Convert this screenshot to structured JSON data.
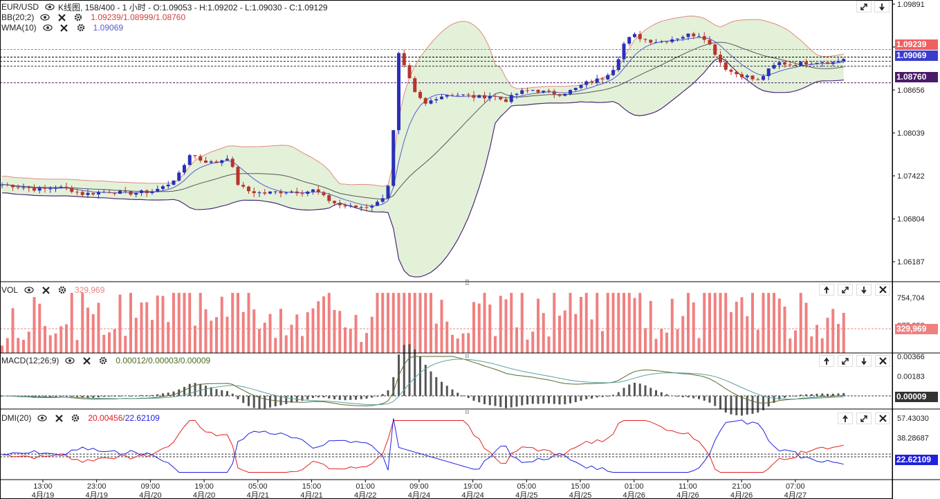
{
  "main": {
    "symbol": "EUR/USD",
    "info": "K线图, 158/400 - 1 小时 - O:1.09053 - H:1.09202 - L:1.09030 - C:1.09129",
    "indicators": [
      {
        "label": "BB(20;2)",
        "values": "1.09239/1.08999/1.08760"
      },
      {
        "label": "WMA(10)",
        "values": "1.09069"
      }
    ],
    "axis_ticks": [
      "1.09891",
      "1.09274",
      "1.08656",
      "1.08039",
      "1.07422",
      "1.06804",
      "1.06187"
    ],
    "price_tags": {
      "bb_upper": "1.09239",
      "wma": "1.09069",
      "bb_lower": "1.08760"
    }
  },
  "vol": {
    "label": "VOL",
    "value": "329,969",
    "axis_ticks": [
      "754,704",
      "377,352"
    ],
    "tag": "329,969"
  },
  "macd": {
    "label": "MACD(12;26;9)",
    "values": "0.00012/0.00003/0.00009",
    "axis_ticks": [
      "0.00366",
      "0.00183"
    ],
    "tag": "0.00009"
  },
  "dmi": {
    "label": "DMI(20)",
    "value_plus": "20.00456",
    "value_minus": "22.62109",
    "axis_ticks": [
      "57.43030",
      "38.28687"
    ],
    "tag": "22.62109"
  },
  "time_axis": {
    "times": [
      "13:00",
      "23:00",
      "09:00",
      "19:00",
      "05:00",
      "15:00",
      "01:00",
      "09:00",
      "19:00",
      "05:00",
      "15:00",
      "01:00",
      "11:00",
      "21:00",
      "07:00"
    ],
    "dates": [
      "4月/19",
      "4月/19",
      "4月/20",
      "4月/20",
      "4月/21",
      "4月/21",
      "4月/22",
      "4月/24",
      "4月/24",
      "4月/25",
      "4月/25",
      "4月/26",
      "4月/26",
      "4月/26",
      "4月/27"
    ]
  },
  "colors": {
    "up": "#2b2fb8",
    "down": "#b8342b",
    "band_fill": "#e3f1d9",
    "band_upper": "#e08a80",
    "band_lower": "#4a2a75",
    "mid": "#555555",
    "wma": "#5a5acb",
    "vol": "#f08080",
    "dmi_plus": "#e02020",
    "dmi_minus": "#2020e0"
  },
  "chart_data": {
    "type": "candlestick",
    "series_summary": "EUR/USD 1h candles, BB(20;2), WMA(10), volume, MACD, DMI",
    "ylim": [
      1.059,
      1.0995
    ],
    "close_path": [
      [
        0,
        1.073
      ],
      [
        20,
        1.0728
      ],
      [
        40,
        1.0725
      ],
      [
        60,
        1.0722
      ],
      [
        80,
        1.0726
      ],
      [
        100,
        1.0723
      ],
      [
        120,
        1.0716
      ],
      [
        140,
        1.0718
      ],
      [
        160,
        1.072
      ],
      [
        180,
        1.0717
      ],
      [
        200,
        1.0718
      ],
      [
        220,
        1.072
      ],
      [
        240,
        1.0728
      ],
      [
        260,
        1.0745
      ],
      [
        275,
        1.0775
      ],
      [
        290,
        1.0765
      ],
      [
        310,
        1.076
      ],
      [
        330,
        1.077
      ],
      [
        345,
        1.0728
      ],
      [
        360,
        1.072
      ],
      [
        380,
        1.0717
      ],
      [
        400,
        1.0719
      ],
      [
        420,
        1.072
      ],
      [
        440,
        1.0719
      ],
      [
        455,
        1.0722
      ],
      [
        470,
        1.071
      ],
      [
        490,
        1.07
      ],
      [
        510,
        1.0697
      ],
      [
        530,
        1.0698
      ],
      [
        550,
        1.0705
      ],
      [
        565,
        1.0738
      ],
      [
        575,
        1.092
      ],
      [
        590,
        1.0885
      ],
      [
        600,
        1.086
      ],
      [
        615,
        1.0845
      ],
      [
        630,
        1.0855
      ],
      [
        650,
        1.086
      ],
      [
        670,
        1.0858
      ],
      [
        690,
        1.0855
      ],
      [
        710,
        1.0858
      ],
      [
        730,
        1.085
      ],
      [
        750,
        1.0862
      ],
      [
        770,
        1.0866
      ],
      [
        790,
        1.0862
      ],
      [
        810,
        1.086
      ],
      [
        830,
        1.0866
      ],
      [
        845,
        1.0875
      ],
      [
        870,
        1.0882
      ],
      [
        890,
        1.09
      ],
      [
        900,
        1.093
      ],
      [
        915,
        1.0945
      ],
      [
        935,
        1.0937
      ],
      [
        955,
        1.0935
      ],
      [
        975,
        1.094
      ],
      [
        995,
        1.0945
      ],
      [
        1015,
        1.0945
      ],
      [
        1030,
        1.0925
      ],
      [
        1045,
        1.09
      ],
      [
        1060,
        1.089
      ],
      [
        1080,
        1.0885
      ],
      [
        1095,
        1.0878
      ],
      [
        1110,
        1.0893
      ],
      [
        1125,
        1.0905
      ],
      [
        1145,
        1.0902
      ],
      [
        1165,
        1.0905
      ],
      [
        1185,
        1.0907
      ],
      [
        1205,
        1.0905
      ],
      [
        1225,
        1.0913
      ]
    ]
  }
}
